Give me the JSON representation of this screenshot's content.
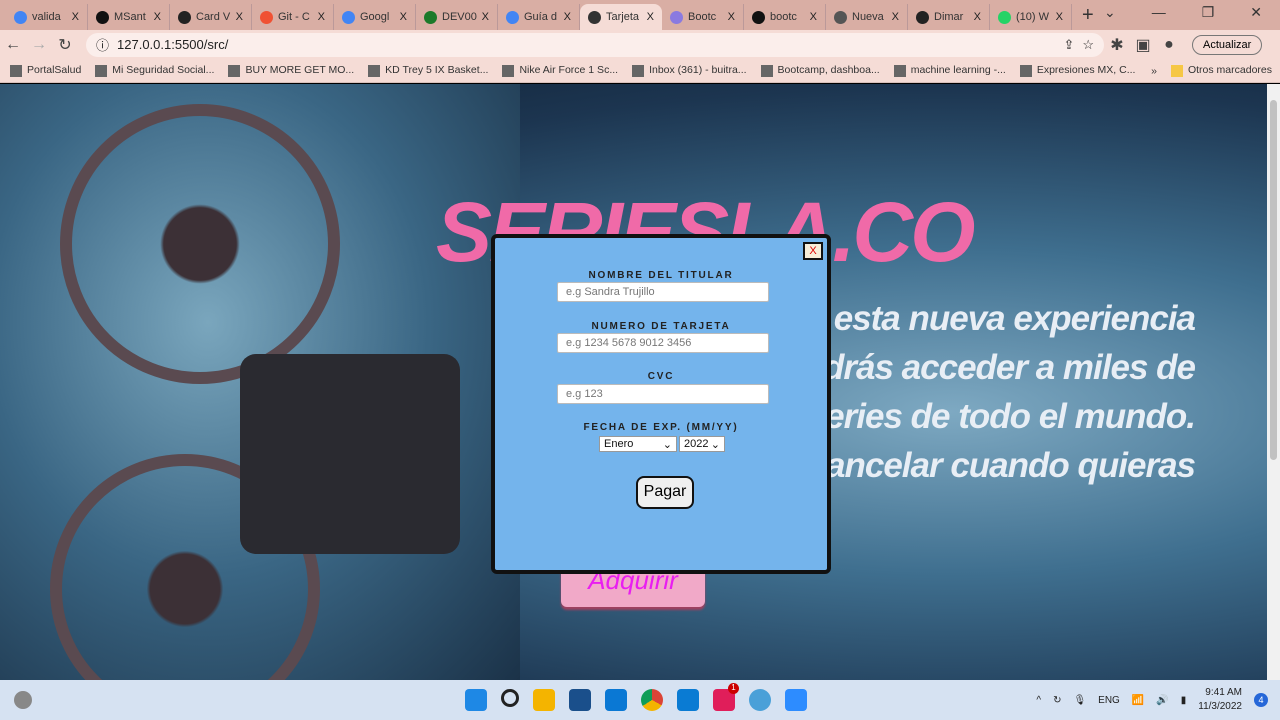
{
  "browser": {
    "tabs": [
      {
        "label": "valida",
        "color": "#4285f4"
      },
      {
        "label": "MSant",
        "color": "#111"
      },
      {
        "label": "Card V",
        "color": "#222"
      },
      {
        "label": "Git - C",
        "color": "#f05133"
      },
      {
        "label": "Googl",
        "color": "#4285f4"
      },
      {
        "label": "DEV00",
        "color": "#1b7a2a"
      },
      {
        "label": "Guía d",
        "color": "#4285f4"
      },
      {
        "label": "Tarjeta",
        "color": "#333",
        "active": true
      },
      {
        "label": "Bootc",
        "color": "#8a7ae0"
      },
      {
        "label": "bootc",
        "color": "#111"
      },
      {
        "label": "Nueva",
        "color": "#555"
      },
      {
        "label": "Dimar",
        "color": "#222"
      },
      {
        "label": "(10) W",
        "color": "#25d366"
      }
    ],
    "tab_close": "X",
    "new_tab": "+",
    "url": "127.0.0.1:5500/src/",
    "update_label": "Actualizar",
    "bookmarks": [
      "PortalSalud",
      "Mi Seguridad Social...",
      "BUY MORE GET MO...",
      "KD Trey 5 IX Basket...",
      "Nike Air Force 1 Sc...",
      "Inbox (361) - buitra...",
      "Bootcamp, dashboa...",
      "machine learning -...",
      "Expresiones MX, C..."
    ],
    "bookmarks_more": "»",
    "other_bookmarks": "Otros marcadores"
  },
  "page": {
    "brand": "SERIESLA.CO",
    "promo_lines": [
      "esta nueva experiencia",
      "drás acceder a miles de",
      "series de todo el mundo.",
      "ancelar cuando quieras"
    ],
    "buy_button": "Adquirir"
  },
  "modal": {
    "close": "X",
    "holder_label": "NOMBRE DEL TITULAR",
    "holder_placeholder": "e.g Sandra Trujillo",
    "card_label": "NUMERO DE TARJETA",
    "card_placeholder": "e.g 1234 5678 9012 3456",
    "cvc_label": "CVC",
    "cvc_placeholder": "e.g 123",
    "exp_label": "FECHA DE EXP. (MM/YY)",
    "month": "Enero",
    "year": "2022",
    "pay_button": "Pagar"
  },
  "taskbar": {
    "lang": "ENG",
    "time": "9:41 AM",
    "date": "11/3/2022",
    "notifications": "4",
    "slack_badge": "1"
  }
}
